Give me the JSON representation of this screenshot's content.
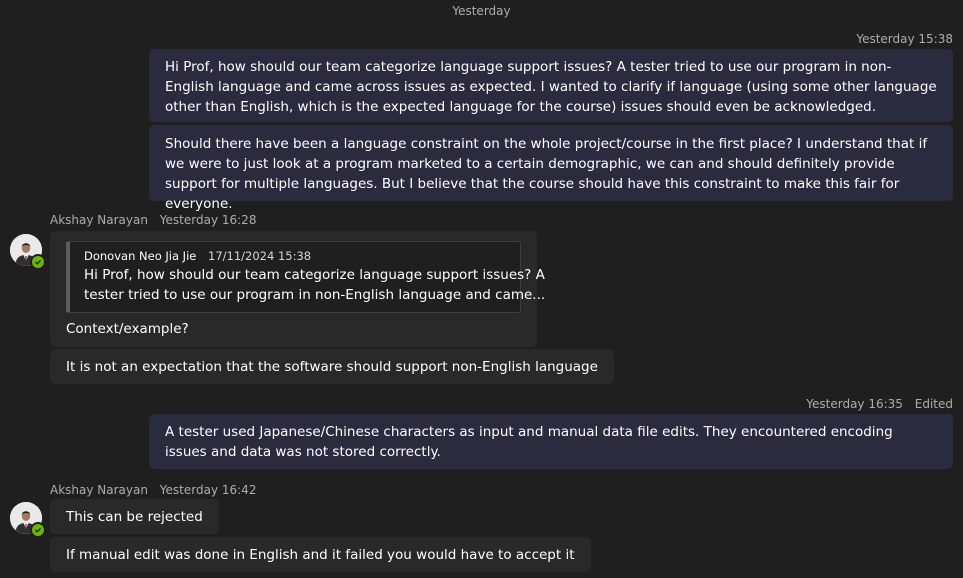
{
  "date_divider": "Yesterday",
  "messages": [
    {
      "meta": {
        "time": "Yesterday 15:38"
      },
      "bubbles": [
        "Hi Prof, how should our team categorize language support issues? A tester tried to use our program in non-English language and came across issues as expected. I wanted to clarify if language (using some other language other than English, which is the expected language for the course) issues should even be acknowledged.",
        "Should there have been a language constraint on the whole project/course in the first place? I understand that if we were to just look at a program marketed to a certain demographic, we can and should definitely provide support for multiple languages. But I believe that the course should have this constraint to make this fair for everyone."
      ]
    },
    {
      "meta": {
        "sender": "Akshay Narayan",
        "time": "Yesterday 16:28"
      },
      "quote": {
        "sender": "Donovan Neo Jia Jie",
        "time": "17/11/2024 15:38",
        "line1": "Hi Prof, how should our team categorize language support issues? A",
        "line2": "tester tried to use our program in non-English language and came..."
      },
      "bubbles": [
        "Context/example?",
        "It is not an expectation that the software should support non-English language"
      ]
    },
    {
      "meta": {
        "time": "Yesterday 16:35",
        "edited": "Edited"
      },
      "bubbles": [
        "A tester used Japanese/Chinese characters as input and manual data file edits. They encountered encoding issues and data was not stored correctly."
      ]
    },
    {
      "meta": {
        "sender": "Akshay Narayan",
        "time": "Yesterday 16:42"
      },
      "bubbles": [
        "This can be rejected",
        "If manual edit was done in English and it failed you would have to accept it"
      ]
    }
  ],
  "colors": {
    "background": "#1f1f1f",
    "own_bubble": "#2b2b40",
    "other_bubble": "#292929",
    "meta_text": "#adadad",
    "presence_available": "#6bb700"
  },
  "icons": [
    "avatar-akshay",
    "presence-available-icon"
  ]
}
